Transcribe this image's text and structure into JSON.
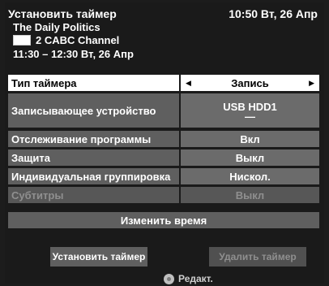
{
  "header": {
    "title": "Установить таймер",
    "clock": "10:50 Вт, 26 Апр",
    "program_name": "The Daily Politics",
    "channel": "2 CABC Channel",
    "time_range": "11:30 – 12:30 Вт, 26 Апр"
  },
  "rows": [
    {
      "label": "Тип таймера",
      "value": "Запись"
    },
    {
      "label": "Записывающее устройство",
      "value": "USB HDD1",
      "value2": "—"
    },
    {
      "label": "Отслеживание программы",
      "value": "Вкл"
    },
    {
      "label": "Защита",
      "value": "Выкл"
    },
    {
      "label": "Индивидуальная группировка",
      "value": "Нискол."
    },
    {
      "label": "Субтитры",
      "value": "Выкл"
    }
  ],
  "change_time_label": "Изменить время",
  "buttons": {
    "set_timer": "Установить таймер",
    "delete_timer": "Удалить таймер"
  },
  "edit_hint": "Редакт.",
  "icons": {
    "left_arrow": "◀",
    "right_arrow": "▶"
  }
}
